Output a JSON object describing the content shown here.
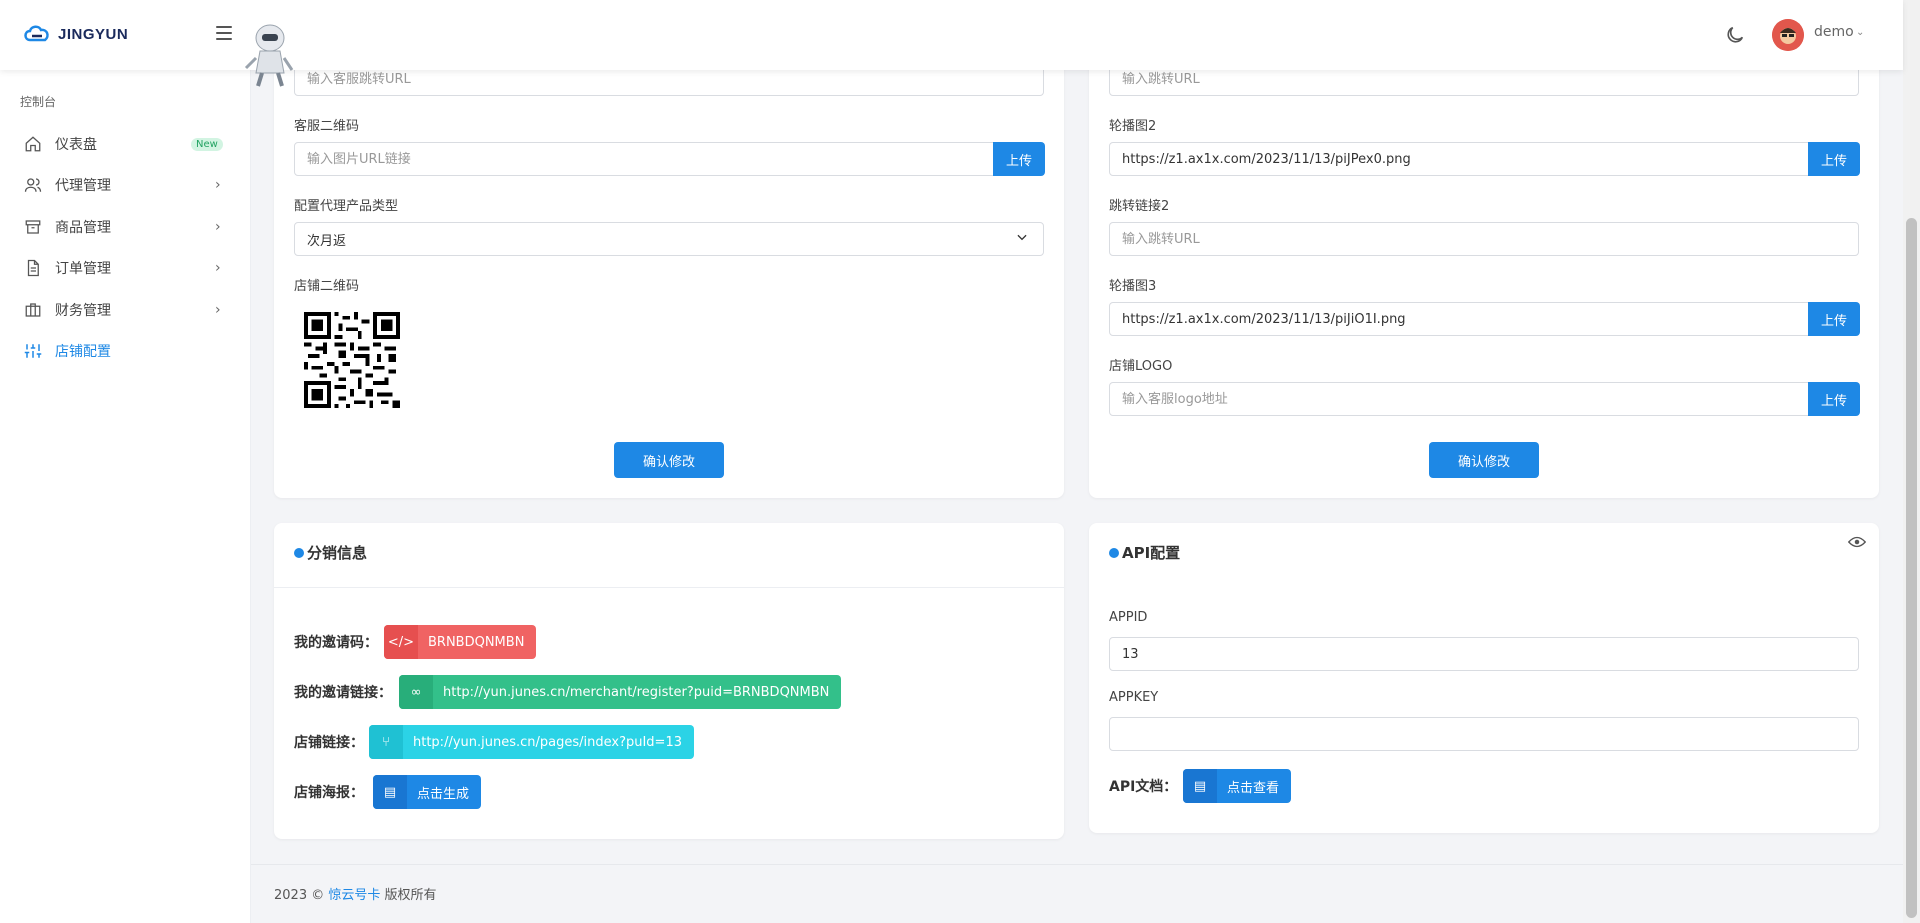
{
  "header": {
    "brand": "JINGYUN",
    "username": "demo"
  },
  "sidebar": {
    "caption": "控制台",
    "items": [
      {
        "label": "仪表盘",
        "icon": "home-icon",
        "badge": "New"
      },
      {
        "label": "代理管理",
        "icon": "users-icon"
      },
      {
        "label": "商品管理",
        "icon": "box-icon"
      },
      {
        "label": "订单管理",
        "icon": "document-icon"
      },
      {
        "label": "财务管理",
        "icon": "briefcase-icon"
      },
      {
        "label": "店铺配置",
        "icon": "sliders-icon",
        "active": true
      }
    ]
  },
  "left_card": {
    "service_url_placeholder": "输入客服跳转URL",
    "qrcode_label": "客服二维码",
    "qrcode_placeholder": "输入图片URL链接",
    "upload_label": "上传",
    "product_type_label": "配置代理产品类型",
    "product_type_value": "次月返",
    "shop_qr_label": "店铺二维码",
    "confirm_label": "确认修改"
  },
  "right_card": {
    "jump_url_placeholder": "输入跳转URL",
    "carousel2_label": "轮播图2",
    "carousel2_value": "https://z1.ax1x.com/2023/11/13/piJPex0.png",
    "link2_label": "跳转链接2",
    "link2_placeholder": "输入跳转URL",
    "carousel3_label": "轮播图3",
    "carousel3_value": "https://z1.ax1x.com/2023/11/13/piJiO1I.png",
    "logo_label": "店铺LOGO",
    "logo_placeholder": "输入客服logo地址",
    "upload_label": "上传",
    "confirm_label": "确认修改"
  },
  "distribution": {
    "title": "分销信息",
    "invite_code_label": "我的邀请码：",
    "invite_code": "BRNBDQNMBN",
    "invite_link_label": "我的邀请链接：",
    "invite_link": "http://yun.junes.cn/merchant/register?puid=BRNBDQNMBN",
    "shop_link_label": "店铺链接：",
    "shop_link": "http://yun.junes.cn/pages/index?puId=13",
    "poster_label": "店铺海报：",
    "poster_button": "点击生成"
  },
  "api": {
    "title": "API配置",
    "appid_label": "APPID",
    "appid_value": "13",
    "appkey_label": "APPKEY",
    "appkey_value": "",
    "doc_label": "API文档：",
    "doc_button": "点击查看"
  },
  "footer": {
    "year": "2023 ©",
    "brand": "惊云号卡",
    "suffix": "版权所有"
  },
  "colors": {
    "primary": "#1e88e5",
    "red": "#f06363",
    "green": "#33c08a",
    "cyan": "#2bd3e6"
  }
}
